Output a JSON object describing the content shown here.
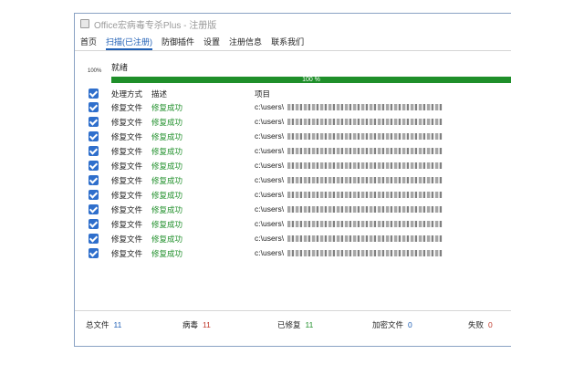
{
  "window": {
    "title": "Office宏病毒专杀Plus - 注册版"
  },
  "menu": [
    {
      "label": "首页",
      "active": false
    },
    {
      "label": "扫描(已注册)",
      "active": true
    },
    {
      "label": "防御插件",
      "active": false
    },
    {
      "label": "设置",
      "active": false
    },
    {
      "label": "注册信息",
      "active": false
    },
    {
      "label": "联系我们",
      "active": false
    }
  ],
  "status": {
    "percent_small": "100%",
    "text": "就绪",
    "progress_label": "100 %",
    "progress_fraction": 1.0
  },
  "table": {
    "columns": {
      "method": "处理方式",
      "desc": "描述",
      "path": "项目"
    },
    "rows": [
      {
        "method": "修复文件",
        "desc": "修复成功",
        "path": "c:\\users\\"
      },
      {
        "method": "修复文件",
        "desc": "修复成功",
        "path": "c:\\users\\"
      },
      {
        "method": "修复文件",
        "desc": "修复成功",
        "path": "c:\\users\\"
      },
      {
        "method": "修复文件",
        "desc": "修复成功",
        "path": "c:\\users\\"
      },
      {
        "method": "修复文件",
        "desc": "修复成功",
        "path": "c:\\users\\"
      },
      {
        "method": "修复文件",
        "desc": "修复成功",
        "path": "c:\\users\\"
      },
      {
        "method": "修复文件",
        "desc": "修复成功",
        "path": "c:\\users\\"
      },
      {
        "method": "修复文件",
        "desc": "修复成功",
        "path": "c:\\users\\"
      },
      {
        "method": "修复文件",
        "desc": "修复成功",
        "path": "c:\\users\\"
      },
      {
        "method": "修复文件",
        "desc": "修复成功",
        "path": "c:\\users\\"
      },
      {
        "method": "修复文件",
        "desc": "修复成功",
        "path": "c:\\users\\"
      }
    ]
  },
  "footer": {
    "total_label": "总文件",
    "total_value": "11",
    "virus_label": "病毒",
    "virus_value": "11",
    "fixed_label": "已修复",
    "fixed_value": "11",
    "encrypted_label": "加密文件",
    "encrypted_value": "0",
    "failed_label": "失败",
    "failed_value": "0"
  },
  "colors": {
    "accent": "#1f5fb5",
    "success": "#1f8f2a",
    "danger": "#c0392b",
    "checkbox": "#2f6fcc"
  }
}
